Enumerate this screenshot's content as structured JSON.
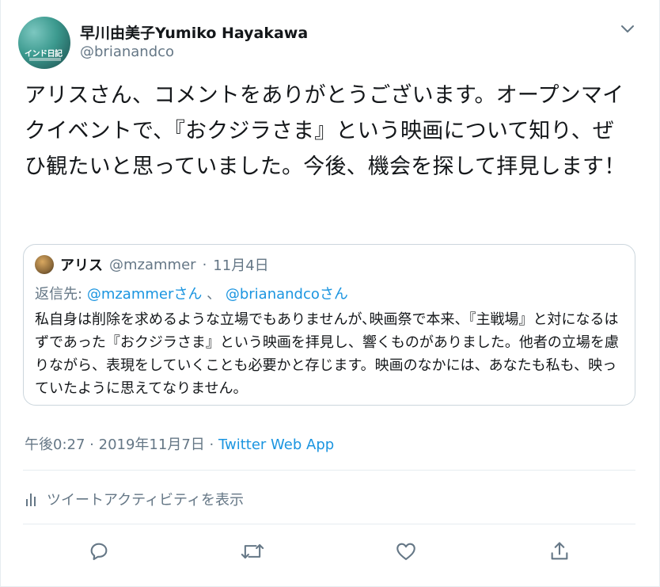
{
  "author": {
    "display_name": "早川由美子Yumiko Hayakawa",
    "handle": "@brianandco",
    "avatar_icon": "profile-photo-icon"
  },
  "tweet": {
    "text": "アリスさん、コメントをありがとうございます。オープンマイクイベントで、『おクジラさま』という映画について知り、ぜひ観たいと思っていました。今後、機会を探して拝見します！"
  },
  "quoted_tweet": {
    "author_name": "アリス",
    "handle": "@mzammer",
    "separator": "·",
    "date": "11月4日",
    "reply_prefix": "返信先:",
    "reply_user1": "@mzammerさん",
    "reply_sep": "、",
    "reply_user2": "@brianandcoさん",
    "text": "私自身は削除を求めるような立場でもありませんが､映画祭で本来、『主戦場』と対になるはずであった『おクジラさま』という映画を拝見し、響くものがありました。他者の立場を慮りながら、表現をしていくことも必要かと存じます。映画のなかには、あなたも私も、映っていたように思えてなりません。"
  },
  "timestamp": {
    "time": "午後0:27",
    "sep1": "·",
    "date": "2019年11月7日",
    "sep2": "·",
    "app": "Twitter Web App"
  },
  "activity": {
    "label": "ツイートアクティビティを表示",
    "icon": "bar-chart-icon"
  },
  "actions": {
    "reply_icon": "reply-icon",
    "retweet_icon": "retweet-icon",
    "like_icon": "heart-icon",
    "share_icon": "share-icon"
  },
  "colors": {
    "text_primary": "#14171a",
    "text_secondary": "#657786",
    "link": "#1b95e0",
    "border": "#e6ecf0"
  }
}
